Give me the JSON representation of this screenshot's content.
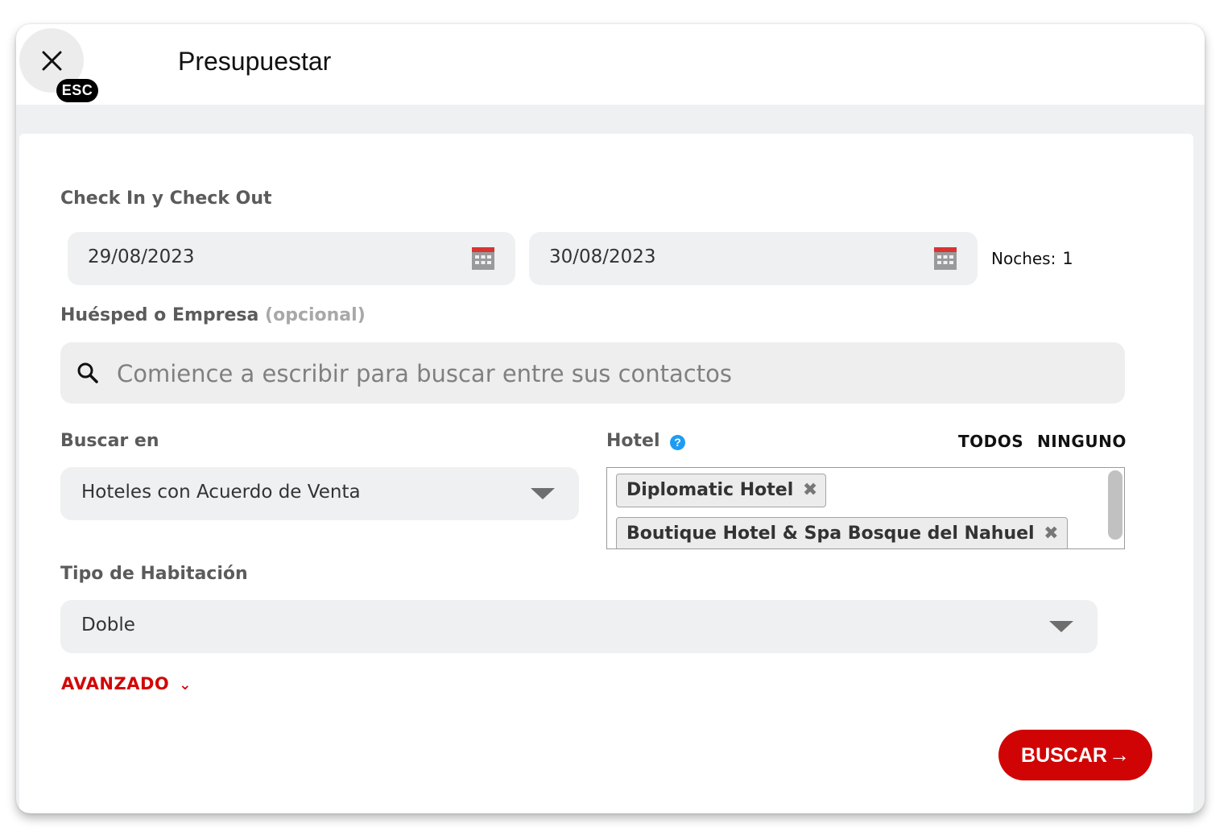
{
  "header": {
    "close_label": "ESC",
    "title": "Presupuestar"
  },
  "dates": {
    "label": "Check In y Check Out",
    "check_in": "29/08/2023",
    "check_out": "30/08/2023",
    "nights_label": "Noches:",
    "nights_value": "1"
  },
  "guest": {
    "label": "Huésped o Empresa",
    "optional": "(opcional)",
    "placeholder": "Comience a escribir para buscar entre sus contactos"
  },
  "search_in": {
    "label": "Buscar en",
    "selected": "Hoteles con Acuerdo de Venta"
  },
  "hotel": {
    "label": "Hotel",
    "help": "?",
    "all_label": "TODOS",
    "none_label": "NINGUNO",
    "selected": [
      {
        "name": "Diplomatic Hotel",
        "remove": "✖"
      },
      {
        "name": "Boutique Hotel & Spa Bosque del Nahuel",
        "remove": "✖"
      }
    ]
  },
  "room_type": {
    "label": "Tipo de Habitación",
    "selected": "Doble"
  },
  "advanced": {
    "label": "AVANZADO",
    "chevron": "⌄"
  },
  "submit": {
    "label": "BUSCAR",
    "arrow": "→"
  },
  "colors": {
    "accent_red": "#d00404",
    "help_blue": "#1e9cf2",
    "field_bg": "#eef0f1"
  },
  "icons": {
    "close": "close-icon",
    "calendar": "calendar-icon",
    "search": "search-icon",
    "help": "help-icon",
    "caret": "caret-down-icon"
  }
}
